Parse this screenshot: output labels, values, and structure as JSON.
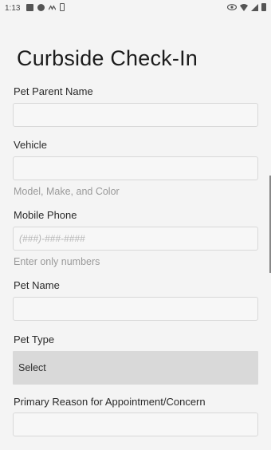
{
  "status_bar": {
    "time": "1:13",
    "left_icons": [
      "notification-square-icon",
      "circle-app-icon",
      "wave-icon",
      "battery-outline-icon"
    ],
    "right_icons": [
      "eye-icon",
      "wifi-icon",
      "signal-icon",
      "battery-icon"
    ]
  },
  "page": {
    "title": "Curbside Check-In"
  },
  "form": {
    "pet_parent_name": {
      "label": "Pet Parent Name",
      "value": "",
      "placeholder": ""
    },
    "vehicle": {
      "label": "Vehicle",
      "value": "",
      "placeholder": "",
      "helper": "Model, Make, and Color"
    },
    "mobile_phone": {
      "label": "Mobile Phone",
      "value": "",
      "placeholder": "(###)-###-####",
      "helper": "Enter only numbers"
    },
    "pet_name": {
      "label": "Pet Name",
      "value": "",
      "placeholder": ""
    },
    "pet_type": {
      "label": "Pet Type",
      "selected": "Select"
    },
    "reason": {
      "label": "Primary Reason for Appointment/Concern",
      "value": "",
      "placeholder": ""
    }
  }
}
